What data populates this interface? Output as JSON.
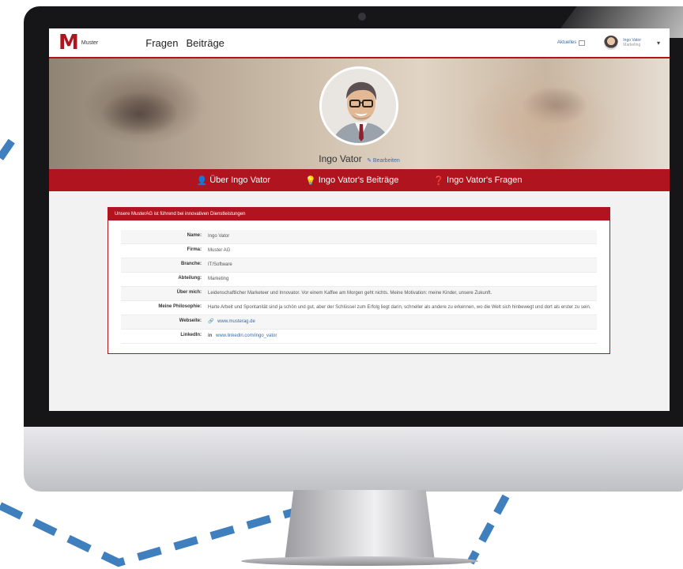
{
  "app": {
    "logo_text": "Muster",
    "logo_mark": "M"
  },
  "nav": {
    "items": [
      {
        "label": "Fragen"
      },
      {
        "label": "Beiträge"
      }
    ]
  },
  "topbar": {
    "notifications_label": "Aktuelles",
    "user_name": "Ingo Vator",
    "user_role": "Marketing"
  },
  "profile": {
    "name": "Ingo Vator",
    "edit_label": "Bearbeiten"
  },
  "subnav": {
    "items": [
      {
        "label": "Über Ingo Vator",
        "icon": "user-icon"
      },
      {
        "label": "Ingo Vator's Beiträge",
        "icon": "lightbulb-icon"
      },
      {
        "label": "Ingo Vator's Fragen",
        "icon": "question-icon"
      }
    ]
  },
  "panel": {
    "title": "Unsere MusterAG ist führend bei innovativen Dienstleistungen",
    "rows": [
      {
        "label": "Name:",
        "value": "Ingo Vator"
      },
      {
        "label": "Firma:",
        "value": "Muster AG"
      },
      {
        "label": "Branche:",
        "value": "IT/Software"
      },
      {
        "label": "Abteilung:",
        "value": "Marketing"
      },
      {
        "label": "Über mich:",
        "value": "Leidenschaftlicher Marketeer und Innovator. Vor einem Kaffee am Morgen geht nichts. Meine Motivation: meine Kinder, unsere Zukunft."
      },
      {
        "label": "Meine Philosophie:",
        "value": "Harte Arbeit und Spontanität sind ja schön und gut, aber der Schlüssel zum Erfolg liegt darin, schneller als andere zu erkennen, wo die Welt sich hinbewegt und dort als erster zu sein."
      },
      {
        "label": "Webseite:",
        "value": "www.musterag.de",
        "icon": "link-icon"
      },
      {
        "label": "LinkedIn:",
        "value": "www.linkedin.com/ingo_vator",
        "icon": "linkedin-icon"
      }
    ]
  },
  "colors": {
    "brand_red": "#b0141e",
    "link_blue": "#3a6aa8",
    "dash_blue": "#3f7fbd"
  }
}
